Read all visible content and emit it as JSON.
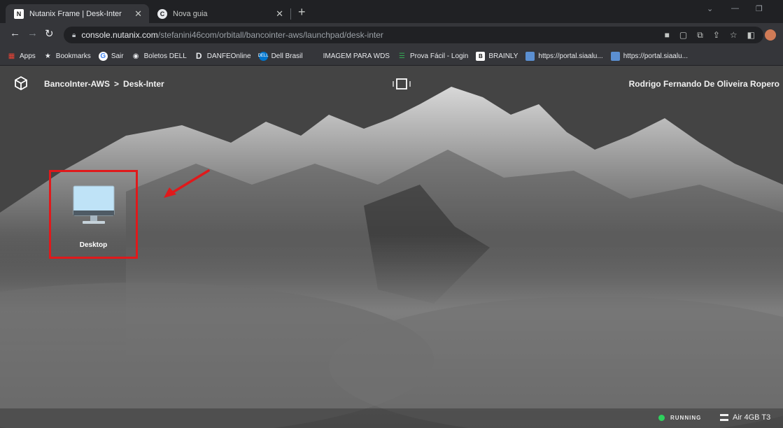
{
  "browser": {
    "tabs": [
      {
        "title": "Nutanix Frame | Desk-Inter",
        "favicon": "N"
      },
      {
        "title": "Nova guia",
        "favicon": "C"
      }
    ],
    "url_host": "console.nutanix.com",
    "url_path": "/stefanini46com/orbitall/bancointer-aws/launchpad/desk-inter",
    "bookmarks": [
      {
        "label": "Apps",
        "icon": "apps-grid-icon",
        "color": "#ea4335"
      },
      {
        "label": "Bookmarks",
        "icon": "star-icon",
        "color": "#e8eaed"
      },
      {
        "label": "Sair",
        "icon": "google-icon",
        "color": "#4285f4"
      },
      {
        "label": "Boletos DELL",
        "icon": "globe-icon",
        "color": "#e8eaed"
      },
      {
        "label": "DANFEOnline",
        "icon": "d-logo-icon",
        "color": "#202124"
      },
      {
        "label": "Dell Brasil",
        "icon": "dell-icon",
        "color": "#0076ce"
      },
      {
        "label": "IMAGEM PARA WDS",
        "icon": "folder-icon",
        "color": "#35363a"
      },
      {
        "label": "Prova Fácil - Login",
        "icon": "list-icon",
        "color": "#34a853"
      },
      {
        "label": "BRAINLY",
        "icon": "brainly-icon",
        "color": "#111111"
      },
      {
        "label": "https://portal.siaalu...",
        "icon": "portal-icon",
        "color": "#5b8fd1"
      },
      {
        "label": "https://portal.siaalu...",
        "icon": "portal-icon",
        "color": "#5b8fd1"
      }
    ]
  },
  "frame": {
    "breadcrumb": [
      "BancoInter-AWS",
      ">",
      "Desk-Inter"
    ],
    "user_name": "Rodrigo Fernando De Oliveira Ropero",
    "app": {
      "label": "Desktop"
    },
    "status": {
      "state": "RUNNING",
      "state_color": "#2ed15d",
      "plan": "Air 4GB T3"
    }
  }
}
